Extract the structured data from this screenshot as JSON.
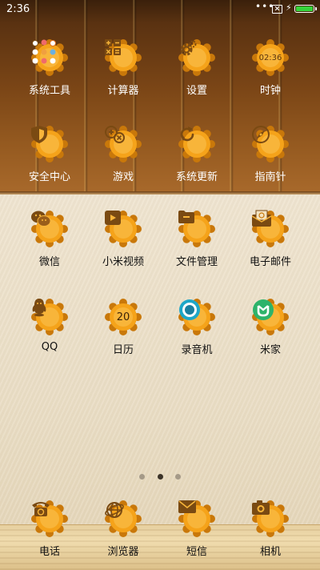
{
  "status_bar": {
    "time": "2:36",
    "more": "•••"
  },
  "wood_apps": [
    {
      "label": "系统工具",
      "icon": "folder-icon"
    },
    {
      "label": "计算器",
      "icon": "calculator-icon"
    },
    {
      "label": "设置",
      "icon": "gear-icon"
    },
    {
      "label": "时钟",
      "icon": "clock-icon",
      "text": "02:36"
    },
    {
      "label": "安全中心",
      "icon": "shield-icon"
    },
    {
      "label": "游戏",
      "icon": "gamepad-icon"
    },
    {
      "label": "系统更新",
      "icon": "refresh-icon"
    },
    {
      "label": "指南针",
      "icon": "compass-icon"
    }
  ],
  "paper_apps": [
    {
      "label": "微信",
      "icon": "chat-bubbles-icon"
    },
    {
      "label": "小米视频",
      "icon": "video-play-icon"
    },
    {
      "label": "文件管理",
      "icon": "folder-icon"
    },
    {
      "label": "电子邮件",
      "icon": "mail-icon"
    },
    {
      "label": "QQ",
      "icon": "penguin-icon"
    },
    {
      "label": "日历",
      "icon": "calendar-icon",
      "text": "20"
    },
    {
      "label": "录音机",
      "icon": "record-icon"
    },
    {
      "label": "米家",
      "icon": "mijia-icon"
    }
  ],
  "dock_apps": [
    {
      "label": "电话",
      "icon": "phone-icon"
    },
    {
      "label": "浏览器",
      "icon": "globe-icon"
    },
    {
      "label": "短信",
      "icon": "message-icon"
    },
    {
      "label": "相机",
      "icon": "camera-icon"
    }
  ],
  "page_indicator": {
    "pages": 3,
    "current": 2
  },
  "colors": {
    "badge": "#f5a31a",
    "badge_dark": "#c9780a",
    "glyph": "#7a4a12",
    "battery": "#35d43a",
    "record": "#1ea7c8",
    "mijia": "#2db36a"
  }
}
